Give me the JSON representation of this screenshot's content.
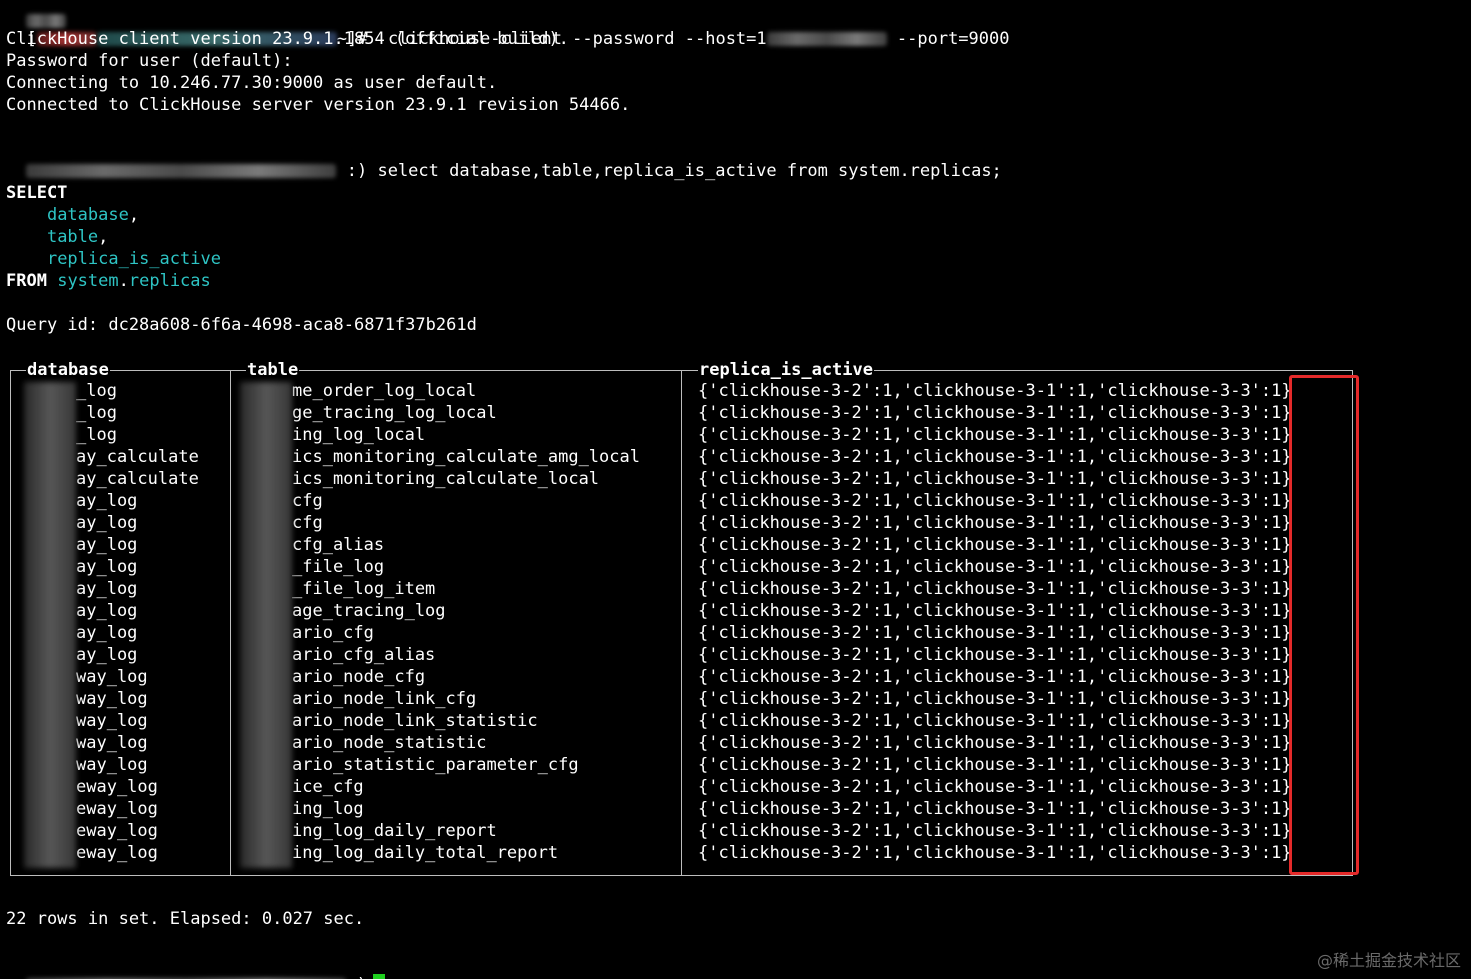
{
  "prompt1": {
    "open": "[",
    "tail": "~]#",
    "command": "clickhouse-client --password --host=1",
    "port_flag": "--port=9000"
  },
  "banner": [
    "ClickHouse client version 23.9.1.1854 (official build).",
    "Password for user (default):",
    "Connecting to 10.246.77.30:9000 as user default.",
    "Connected to ClickHouse server version 23.9.1 revision 54466."
  ],
  "prompt2": {
    "suffix": ":)",
    "query": "select database,table,replica_is_active from system.replicas;"
  },
  "formatted_query": {
    "select_kw": "SELECT",
    "col1": "database",
    "col2": "table",
    "col3": "replica_is_active",
    "comma": ",",
    "from_kw": "FROM",
    "from_db": "system",
    "dot": ".",
    "from_table": "replicas"
  },
  "query_id": "Query id: dc28a608-6f6a-4698-aca8-6871f37b261d",
  "result": {
    "headers": [
      "database",
      "table",
      "replica_is_active"
    ],
    "rows": [
      [
        "_log",
        "me_order_log_local"
      ],
      [
        "_log",
        "ge_tracing_log_local"
      ],
      [
        "_log",
        "ing_log_local"
      ],
      [
        "ay_calculate",
        "ics_monitoring_calculate_amg_local"
      ],
      [
        "ay_calculate",
        "ics_monitoring_calculate_local"
      ],
      [
        "ay_log",
        "cfg"
      ],
      [
        "ay_log",
        "cfg"
      ],
      [
        "ay_log",
        "cfg_alias"
      ],
      [
        "ay_log",
        "_file_log"
      ],
      [
        "ay_log",
        "_file_log_item"
      ],
      [
        "ay_log",
        "age_tracing_log"
      ],
      [
        "ay_log",
        "ario_cfg"
      ],
      [
        "ay_log",
        "ario_cfg_alias"
      ],
      [
        "way_log",
        "ario_node_cfg"
      ],
      [
        "way_log",
        "ario_node_link_cfg"
      ],
      [
        "way_log",
        "ario_node_link_statistic"
      ],
      [
        "way_log",
        "ario_node_statistic"
      ],
      [
        "way_log",
        "ario_statistic_parameter_cfg"
      ],
      [
        "eway_log",
        "ice_cfg"
      ],
      [
        "eway_log",
        "ing_log"
      ],
      [
        "eway_log",
        "ing_log_daily_report"
      ],
      [
        "eway_log",
        "ing_log_daily_total_report"
      ]
    ],
    "replica_value": "{'clickhouse-3-2':1,'clickhouse-3-1':1,'clickhouse-3-3':1}"
  },
  "footer": "22 rows in set. Elapsed: 0.027 sec.",
  "prompt3": {
    "suffix": ")"
  },
  "watermark": "@稀土掘金技术社区",
  "colors": {
    "background": "#000000",
    "text": "#ffffff",
    "identifier": "#2ec4c4",
    "highlight_box": "#e52a2a",
    "cursor": "#1fd11f"
  }
}
